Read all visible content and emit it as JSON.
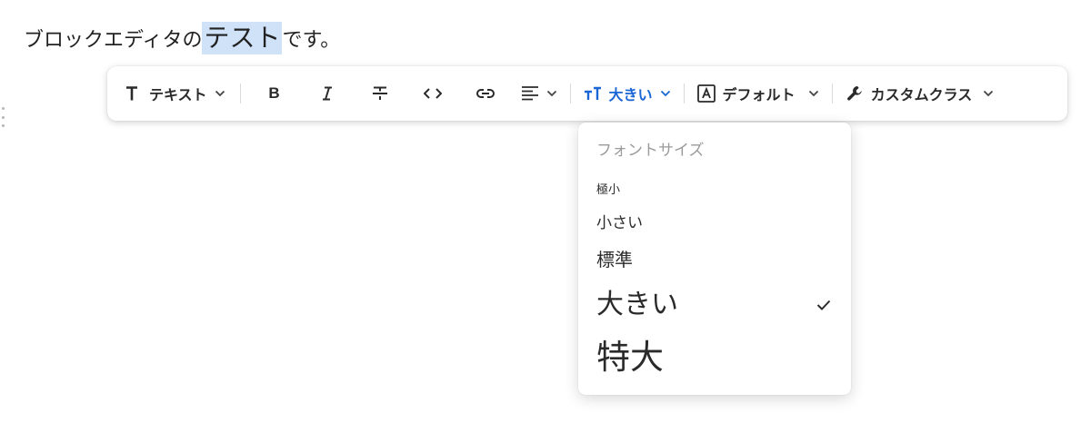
{
  "editor": {
    "text_before": "ブロックエディタの",
    "text_selected": "テスト",
    "text_after": "です。"
  },
  "toolbar": {
    "block_type": {
      "label": "テキスト",
      "icon": "text-type-icon"
    },
    "bold_icon": "bold-icon",
    "italic_icon": "italic-icon",
    "strike_icon": "strikethrough-icon",
    "code_icon": "code-icon",
    "link_icon": "link-icon",
    "align_icon": "align-left-icon",
    "font_size": {
      "label": "大きい",
      "icon": "font-size-icon",
      "color": "#1a66d6"
    },
    "color": {
      "label": "デフォルト",
      "icon": "text-color-icon"
    },
    "custom_class": {
      "label": "カスタムクラス",
      "icon": "wrench-icon"
    }
  },
  "font_size_menu": {
    "header": "フォントサイズ",
    "options": [
      {
        "label": "極小",
        "selected": false
      },
      {
        "label": "小さい",
        "selected": false
      },
      {
        "label": "標準",
        "selected": false
      },
      {
        "label": "大きい",
        "selected": true
      },
      {
        "label": "特大",
        "selected": false
      }
    ]
  }
}
